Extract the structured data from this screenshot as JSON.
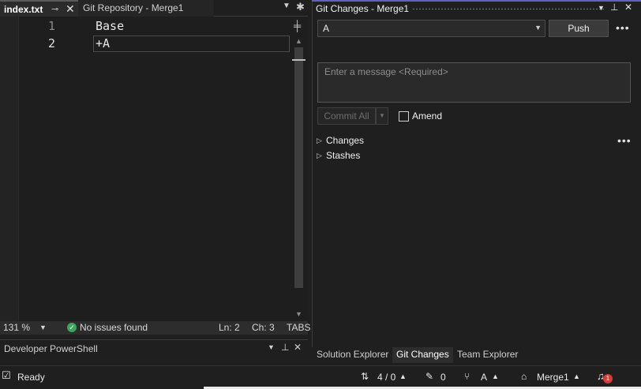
{
  "editor": {
    "tabs": [
      {
        "label": "index.txt"
      },
      {
        "label": "Git Repository - Merge1"
      }
    ],
    "lines": [
      {
        "no": "1",
        "text": "Base"
      },
      {
        "no": "2",
        "text": "+A"
      }
    ],
    "status": {
      "zoom": "131 %",
      "issues": "No issues found",
      "line": "Ln: 2",
      "col": "Ch: 3",
      "indent": "TABS"
    }
  },
  "powershell": {
    "title": "Developer PowerShell"
  },
  "git_changes": {
    "title": "Git Changes - Merge1",
    "branch_value": "A",
    "push_label": "Push",
    "message_placeholder": "Enter a message <Required>",
    "commit_label": "Commit All",
    "amend_label": "Amend",
    "sections": [
      "Changes",
      "Stashes"
    ]
  },
  "bottom_tabs": [
    "Solution Explorer",
    "Git Changes",
    "Team Explorer"
  ],
  "status_bar": {
    "ready": "Ready",
    "push_pull": "4 / 0",
    "pending": "0",
    "branch": "A",
    "repo": "Merge1",
    "notifications": "1"
  },
  "colors": {
    "background": "#1f1f1f",
    "accent": "#6060c0",
    "ok": "#3ea55c",
    "badge": "#d63c3c"
  }
}
